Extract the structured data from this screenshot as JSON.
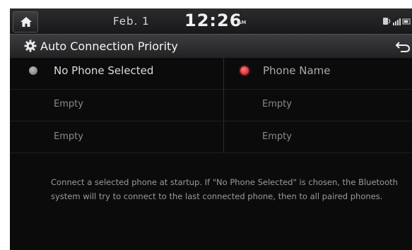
{
  "status_bar": {
    "date": "Feb. 1",
    "time": "12:26",
    "ampm": "AM",
    "icons": [
      "bluetooth-phone-icon",
      "signal-bars-icon",
      "battery-icon"
    ]
  },
  "title_bar": {
    "title": "Auto Connection Priority",
    "icon": "gear-icon",
    "back_icon": "back-arrow-icon"
  },
  "left_column": {
    "selected": false,
    "option_label": "No Phone Selected",
    "slots": [
      "Empty",
      "Empty"
    ]
  },
  "right_column": {
    "selected": true,
    "option_label": "Phone Name",
    "slots": [
      "Empty",
      "Empty"
    ]
  },
  "description": "Connect a selected phone at startup. If \"No Phone Selected\" is chosen, the Bluetooth system will try to connect to the last connected phone, then to all paired phones.",
  "colors": {
    "background": "#0b0b0c",
    "radio_selected": "#d11a22",
    "radio_unselected": "#9a9a9a",
    "text_primary": "#f4f4f4",
    "text_muted": "#8a8a8a"
  }
}
